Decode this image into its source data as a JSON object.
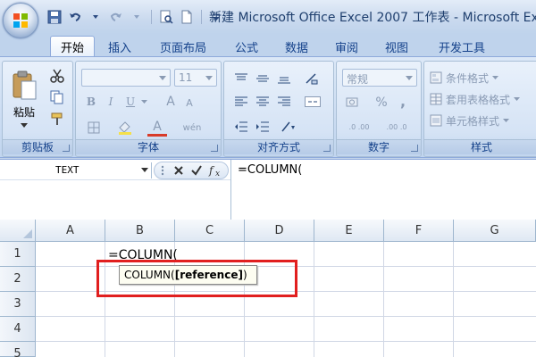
{
  "window": {
    "title": "新建 Microsoft Office Excel 2007 工作表 - Microsoft Excel"
  },
  "tabs": [
    {
      "label": "开始",
      "active": true
    },
    {
      "label": "插入",
      "active": false
    },
    {
      "label": "页面布局",
      "active": false
    },
    {
      "label": "公式",
      "active": false
    },
    {
      "label": "数据",
      "active": false
    },
    {
      "label": "审阅",
      "active": false
    },
    {
      "label": "视图",
      "active": false
    },
    {
      "label": "开发工具",
      "active": false
    }
  ],
  "ribbon": {
    "clipboard": {
      "label": "剪贴板",
      "paste_label": "粘贴"
    },
    "font": {
      "label": "字体",
      "font_size": "11",
      "bold": "B",
      "italic": "I",
      "underline": "U",
      "grow": "A",
      "shrink": "A",
      "font_color": "A",
      "wen": "wén"
    },
    "alignment": {
      "label": "对齐方式"
    },
    "number": {
      "label": "数字",
      "format": "常规",
      "percent": "%",
      "comma": ",",
      "dec_inc": ".0 .00",
      "dec_dec": ".00 .0"
    },
    "styles": {
      "label": "样式",
      "cond_format": "条件格式",
      "table_format": "套用表格格式",
      "cell_styles": "单元格样式"
    }
  },
  "formula_bar": {
    "name_box": "TEXT",
    "formula": "=COLUMN("
  },
  "grid": {
    "columns": [
      "A",
      "B",
      "C",
      "D",
      "E",
      "F",
      "G"
    ],
    "rows": [
      "1",
      "2",
      "3",
      "4",
      "5"
    ],
    "cell_b1": "=COLUMN(",
    "tooltip_func": "COLUMN(",
    "tooltip_arg": "[reference]",
    "tooltip_close": ")"
  },
  "colors": {
    "highlight": "#e11f1f",
    "ribbon_text": "#15428b"
  }
}
